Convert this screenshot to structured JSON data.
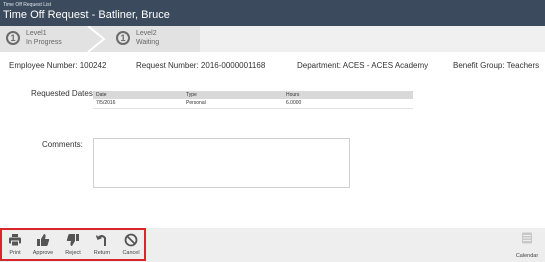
{
  "header": {
    "breadcrumb": "Time Off Request List",
    "title": "Time Off Request - Batliner, Bruce"
  },
  "steps": [
    {
      "number": "1",
      "name": "Level1",
      "status": "In Progress"
    },
    {
      "number": "1",
      "name": "Level2",
      "status": "Waiting"
    }
  ],
  "info": {
    "employee": "Employee Number: 100242",
    "request": "Request Number: 2016-0000001168",
    "department": "Department: ACES - ACES Academy",
    "benefit": "Benefit Group: Teachers"
  },
  "requested_dates": {
    "label": "Requested Dates:",
    "columns": [
      "Date",
      "Type",
      "Hours"
    ],
    "rows": [
      [
        "7/5/2016",
        "Personal",
        "6.0000"
      ]
    ]
  },
  "comments": {
    "label": "Comments:",
    "value": ""
  },
  "actions": {
    "print": "Print",
    "approve": "Approve",
    "reject": "Reject",
    "return": "Return",
    "cancel": "Cancel",
    "calendar": "Calendar"
  },
  "icons": [
    "printer-icon",
    "thumbs-up-icon",
    "thumbs-down-icon",
    "return-arrow-icon",
    "cancel-icon",
    "calendar-icon"
  ],
  "colors": {
    "header_bg": "#3b4a5c",
    "highlight_border": "#d9262c"
  }
}
